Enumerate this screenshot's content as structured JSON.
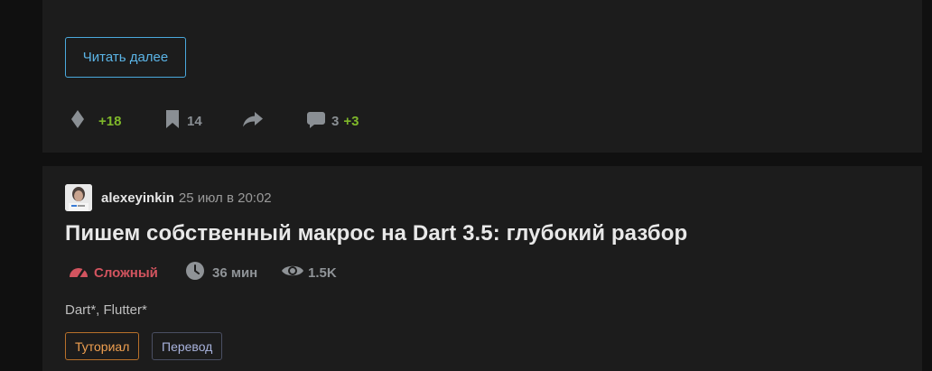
{
  "top_card": {
    "read_more_label": "Читать далее",
    "rating": "+18",
    "bookmarks": "14",
    "comments": "3",
    "new_comments": "+3"
  },
  "article": {
    "author": "alexeyinkin",
    "date": "25 июл в 20:02",
    "title": "Пишем собственный макрос на Dart 3.5: глубокий разбор",
    "difficulty": "Сложный",
    "reading_time": "36 мин",
    "views": "1.5K",
    "hubs": "Dart*, Flutter*",
    "labels": [
      "Туториал",
      "Перевод"
    ]
  },
  "colors": {
    "accent_blue": "#4aa9dd",
    "positive_green": "#7fb82a",
    "difficulty_red": "#d2545f",
    "tutorial_orange": "#f0a050",
    "translation_lavender": "#a9b3dd"
  }
}
